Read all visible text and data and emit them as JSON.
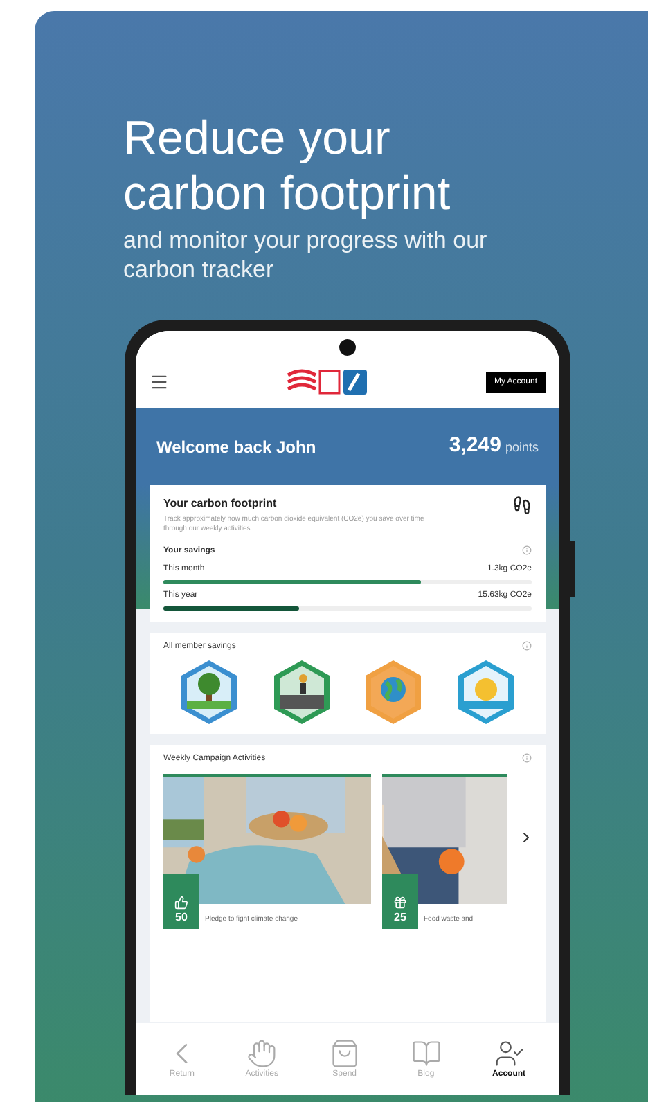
{
  "headline": "Reduce your carbon footprint",
  "subheadline": "and monitor your progress with our carbon tracker",
  "app": {
    "account_button": "My Account",
    "welcome": "Welcome back John",
    "points": "3,249",
    "points_label": "points",
    "footprint_card": {
      "title": "Your carbon footprint",
      "description": "Track approximately how much carbon dioxide equivalent (CO2e) you save over time through our weekly activities.",
      "savings_label": "Your savings",
      "savings": [
        {
          "label": "This month",
          "reading": "1.3kg CO2e",
          "level": 0.7
        },
        {
          "label": "This year",
          "reading": "15.63kg CO2e",
          "level": 0.37
        }
      ]
    },
    "badges_card": {
      "title": "All member savings",
      "badges": [
        {
          "kind": "tree"
        },
        {
          "kind": "road"
        },
        {
          "kind": "globe"
        },
        {
          "kind": "sun"
        }
      ]
    },
    "activities_card": {
      "title": "Weekly Campaign Activities",
      "cards": [
        {
          "points": "50",
          "caption": "Pledge to fight climate change",
          "kind": "picture"
        },
        {
          "points": "25",
          "caption": "Food waste and",
          "kind": "picture"
        }
      ]
    },
    "nav": [
      {
        "label": "Return",
        "selected": false
      },
      {
        "label": "Activities",
        "selected": false
      },
      {
        "label": "Spend",
        "selected": false
      },
      {
        "label": "Blog",
        "selected": false
      },
      {
        "label": "Account",
        "selected": true
      }
    ]
  }
}
